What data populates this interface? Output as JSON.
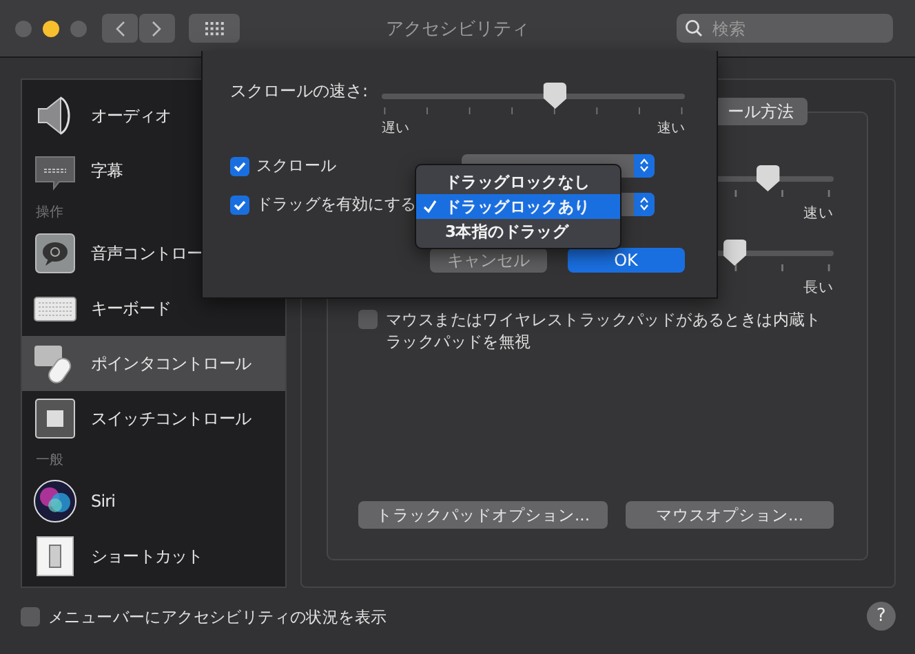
{
  "window": {
    "title": "アクセシビリティ",
    "search": {
      "placeholder": "検索"
    }
  },
  "sidebar": {
    "items": [
      {
        "kind": "item",
        "label": "オーディオ",
        "selected": false
      },
      {
        "kind": "item",
        "label": "字幕",
        "selected": false
      },
      {
        "kind": "header",
        "label": "操作"
      },
      {
        "kind": "item",
        "label": "音声コントロー",
        "selected": false
      },
      {
        "kind": "item",
        "label": "キーボード",
        "selected": false
      },
      {
        "kind": "item",
        "label": "ポインタコントロール",
        "selected": true
      },
      {
        "kind": "item",
        "label": "スイッチコントロール",
        "selected": false
      },
      {
        "kind": "header",
        "label": "一般"
      },
      {
        "kind": "item",
        "label": "Siri",
        "selected": false
      },
      {
        "kind": "item",
        "label": "ショートカット",
        "selected": false
      }
    ]
  },
  "panel": {
    "tab": "ール方法",
    "sliders": [
      {
        "level": 0.86,
        "end_label": "速い"
      },
      {
        "level": 0.79,
        "end_label": "長い"
      }
    ],
    "ignore_checkbox": {
      "label": "マウスまたはワイヤレストラックパッドがあるときは内蔵トラックパッドを無視",
      "checked": false
    },
    "buttons": [
      "トラックパッドオプション...",
      "マウスオプション..."
    ]
  },
  "footer": {
    "menubar_checkbox": {
      "label": "メニューバーにアクセシビリティの状況を表示",
      "checked": false
    },
    "help": "?"
  },
  "sheet": {
    "speed_label": "スクロールの速さ:",
    "speed": {
      "level": 0.57,
      "min_label": "遅い",
      "max_label": "速い"
    },
    "options": [
      {
        "label": "スクロール",
        "checked": true
      },
      {
        "label": "ドラッグを有効にする",
        "checked": true
      }
    ],
    "buttons": [
      "キャンセル",
      "OK"
    ]
  },
  "menu": {
    "items": [
      {
        "label": "ドラッグロックなし",
        "selected": false
      },
      {
        "label": "ドラッグロックあり",
        "selected": true
      },
      {
        "label": "3本指のドラッグ",
        "selected": false
      }
    ]
  }
}
